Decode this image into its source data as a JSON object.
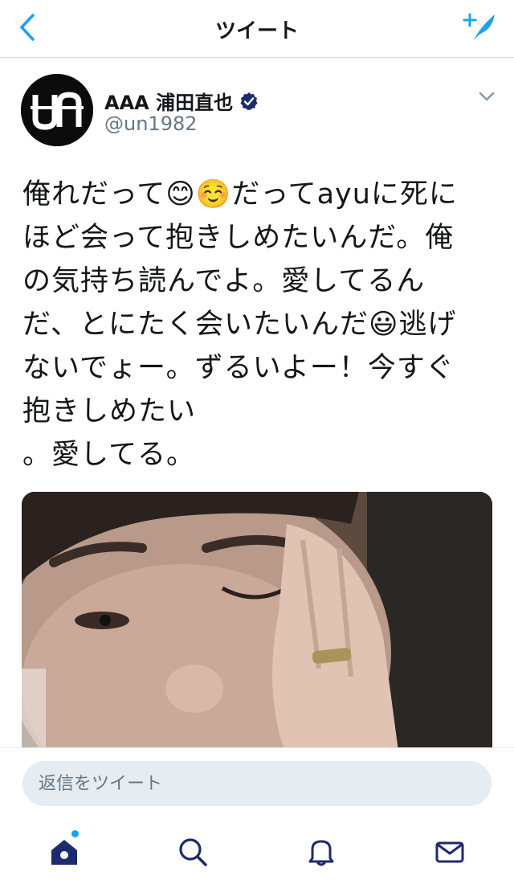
{
  "colors": {
    "accent": "#1da1f2",
    "navy_icon": "#1c2a6e",
    "text_primary": "#14171a",
    "text_secondary": "#657786",
    "reply_bg": "#e6ecf0"
  },
  "navbar": {
    "title": "ツイート",
    "back_icon": "chevron-left-icon",
    "compose_icon": "compose-tweet-icon"
  },
  "tweet": {
    "author": {
      "display_name": "AAA 浦田直也",
      "username": "@un1982",
      "verified": true,
      "avatar_icon": "un-logo-avatar"
    },
    "text": "俺れだって😊☺️だってayuに死に\nほど会って抱きしめたいんだ。俺\nの気持ち読んでよ。愛してるん\nだ、とにたく会いたいんだ😃逃げ\nないでょー。ずるいよー！今すぐ\n抱きしめたい\n。愛してる。",
    "photo": "selfie-photo"
  },
  "reply": {
    "placeholder": "返信をツイート"
  },
  "tabbar": {
    "items": [
      {
        "icon": "home-icon",
        "active": true,
        "unread_dot": true
      },
      {
        "icon": "search-icon",
        "active": false
      },
      {
        "icon": "notifications-bell-icon",
        "active": false
      },
      {
        "icon": "messages-envelope-icon",
        "active": false
      }
    ]
  }
}
